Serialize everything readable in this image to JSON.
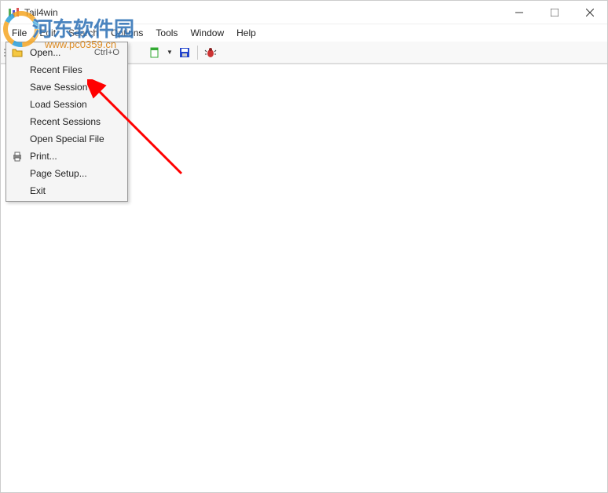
{
  "window": {
    "title": "Tail4win"
  },
  "menubar": {
    "items": [
      "File",
      "Edit",
      "Search",
      "Options",
      "Tools",
      "Window",
      "Help"
    ]
  },
  "file_menu": {
    "items": [
      {
        "label": "Open...",
        "shortcut": "Ctrl+O",
        "icon": "open-icon"
      },
      {
        "label": "Recent Files",
        "shortcut": "",
        "icon": ""
      },
      {
        "label": "Save Session",
        "shortcut": "",
        "icon": ""
      },
      {
        "label": "Load Session",
        "shortcut": "",
        "icon": ""
      },
      {
        "label": "Recent Sessions",
        "shortcut": "",
        "icon": ""
      },
      {
        "label": "Open Special File",
        "shortcut": "",
        "icon": ""
      },
      {
        "label": "Print...",
        "shortcut": "",
        "icon": "print-icon"
      },
      {
        "label": "Page Setup...",
        "shortcut": "",
        "icon": ""
      },
      {
        "label": "Exit",
        "shortcut": "",
        "icon": ""
      }
    ]
  },
  "watermark": {
    "text_cn": "河东软件园",
    "text_url": "www.pc0359.cn"
  }
}
